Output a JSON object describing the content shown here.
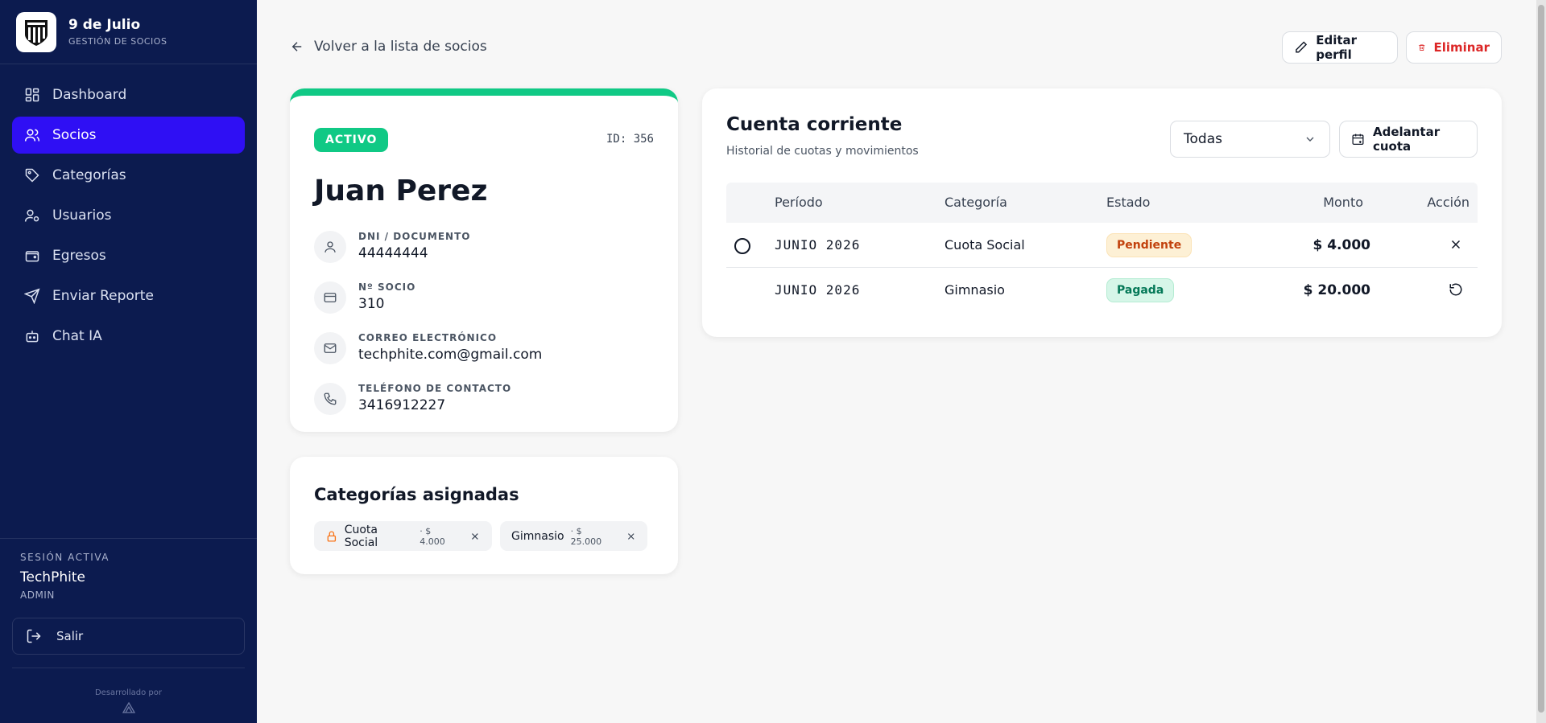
{
  "brand": {
    "title": "9 de Julio",
    "subtitle": "GESTIÓN DE SOCIOS"
  },
  "nav": [
    {
      "label": "Dashboard",
      "icon": "dashboard-icon"
    },
    {
      "label": "Socios",
      "icon": "users-icon",
      "active": true
    },
    {
      "label": "Categorías",
      "icon": "tag-icon"
    },
    {
      "label": "Usuarios",
      "icon": "user-gear-icon"
    },
    {
      "label": "Egresos",
      "icon": "wallet-icon"
    },
    {
      "label": "Enviar Reporte",
      "icon": "send-icon"
    },
    {
      "label": "Chat IA",
      "icon": "bot-icon"
    }
  ],
  "session": {
    "label": "SESIÓN ACTIVA",
    "user": "TechPhite",
    "role": "ADMIN",
    "logout": "Salir",
    "developed_by": "Desarrollado por"
  },
  "header": {
    "back": "Volver a la lista de socios",
    "edit": "Editar perfil",
    "delete": "Eliminar"
  },
  "profile": {
    "status": "ACTIVO",
    "id": "ID: 356",
    "name": "Juan Perez",
    "fields": [
      {
        "label": "DNI / DOCUMENTO",
        "value": "44444444",
        "icon": "user-icon"
      },
      {
        "label": "Nº SOCIO",
        "value": "310",
        "icon": "card-icon"
      },
      {
        "label": "CORREO ELECTRÓNICO",
        "value": "techphite.com@gmail.com",
        "icon": "mail-icon"
      },
      {
        "label": "TELÉFONO DE CONTACTO",
        "value": "3416912227",
        "icon": "phone-icon"
      }
    ]
  },
  "categories": {
    "title": "Categorías asignadas",
    "items": [
      {
        "name": "Cuota Social",
        "price": "· $ 4.000",
        "locked": true
      },
      {
        "name": "Gimnasio",
        "price": "· $ 25.000",
        "locked": false
      }
    ]
  },
  "account": {
    "title": "Cuenta corriente",
    "subtitle": "Historial de cuotas y movimientos",
    "filter": "Todas",
    "advance": "Adelantar cuota",
    "columns": [
      "Período",
      "Categoría",
      "Estado",
      "Monto",
      "Acción"
    ],
    "rows": [
      {
        "period": "JUNIO 2026",
        "category": "Cuota Social",
        "status": "Pendiente",
        "amount": "$ 4.000",
        "action": "close-icon"
      },
      {
        "period": "JUNIO 2026",
        "category": "Gimnasio",
        "status": "Pagada",
        "amount": "$ 20.000",
        "action": "undo-icon"
      }
    ]
  },
  "colors": {
    "sidebar": "#0c1b4f",
    "accent": "#2f0ff4",
    "active_green": "#10c985",
    "danger": "#dc2626"
  }
}
